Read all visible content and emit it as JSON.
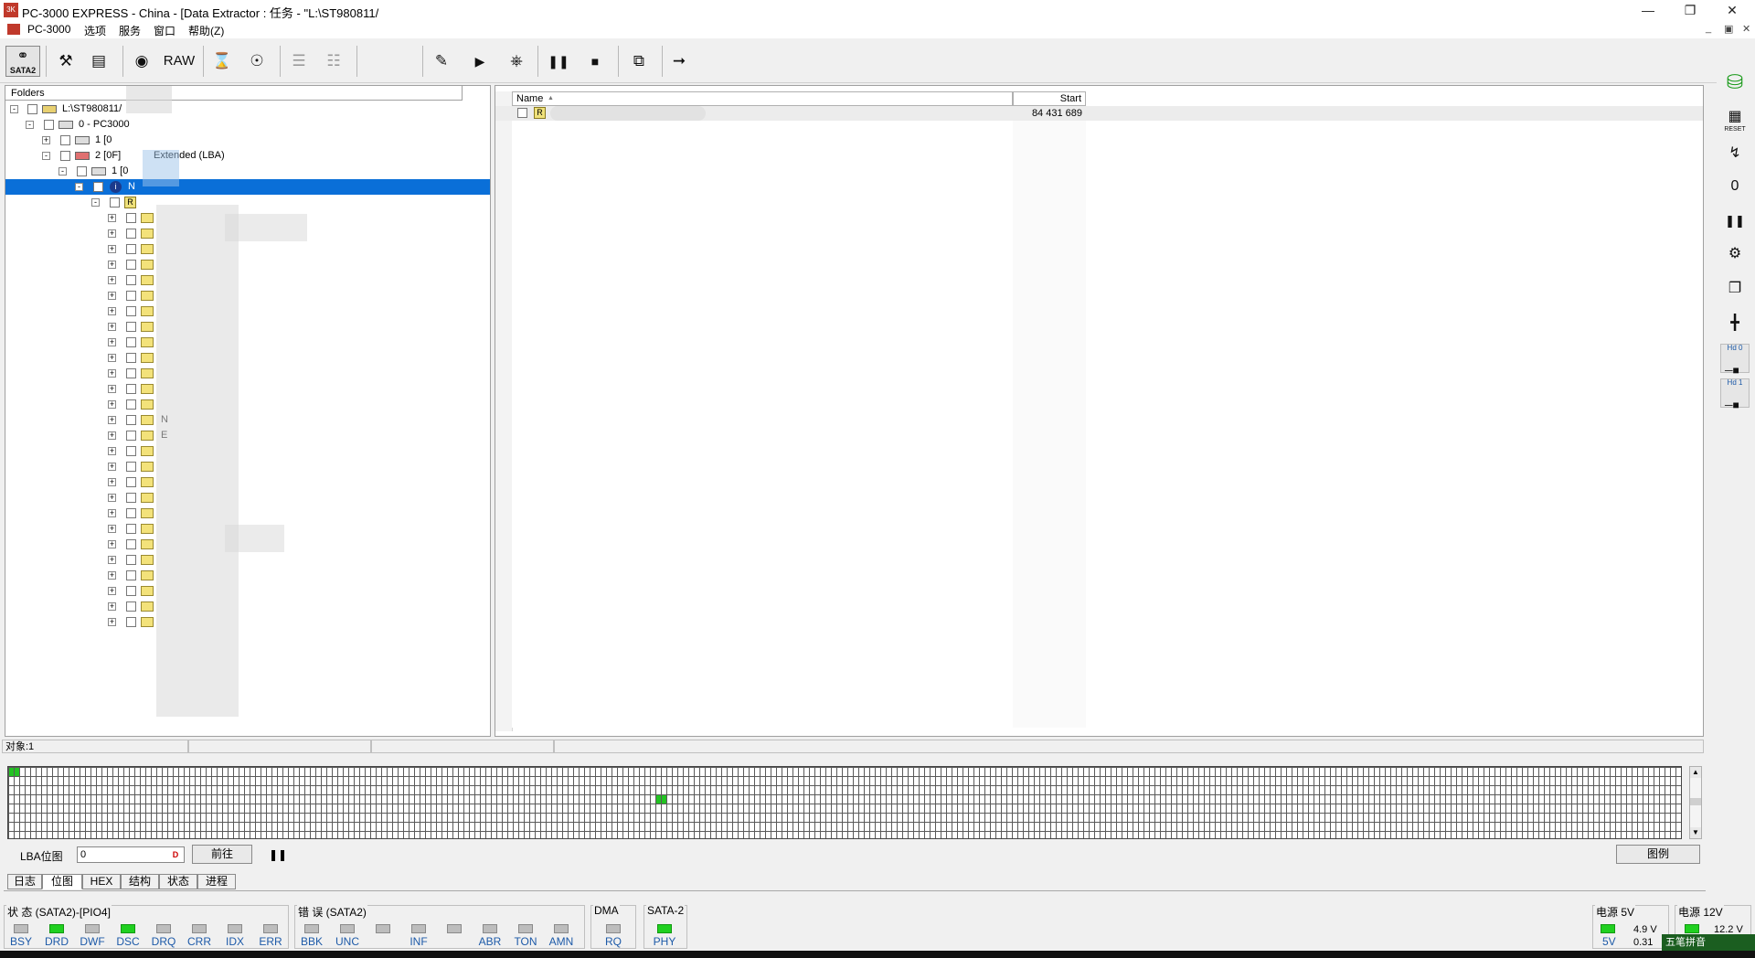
{
  "window": {
    "title": "PC-3000 EXPRESS - China - [Data Extractor : 任务 - \"L:\\ST980811/",
    "app_icon": "pc3000-logo-icon",
    "controls": [
      "minimize",
      "restore",
      "close"
    ]
  },
  "menu": {
    "items": [
      "PC-3000",
      "选项",
      "服务",
      "窗口",
      "帮助(Z)"
    ]
  },
  "toolbar": {
    "sata_label": "SATA2",
    "raw_label": "RAW"
  },
  "side_toolbar": {
    "reset_label": "RESET",
    "hd0_label": "Hd 0",
    "hd1_label": "Hd 1"
  },
  "tree": {
    "header": "Folders",
    "root_label": "L:\\ST980811/",
    "node_device": "0 - PC3000",
    "node_part1": "1 [0",
    "node_part2": "2 [0F]",
    "node_part2_type": "Extended  (LBA)",
    "node_sub1": "1 [0",
    "node_selected": "N",
    "node_root_dir": "R",
    "folder_count": 27,
    "folder_label_n": "N",
    "folder_label_e": "E"
  },
  "list": {
    "columns": [
      "Name",
      "Start"
    ],
    "sort_indicator": "▲",
    "rows": [
      {
        "name_badge": "R",
        "start": "84 431 689"
      }
    ]
  },
  "status": {
    "objects": "对象:1"
  },
  "bitmap": {
    "lba_label": "LBA位图",
    "lba_value": "0",
    "dec_hex_toggle": "D",
    "go_button": "前往",
    "pause_icon": "pause-icon",
    "legend_button": "图例"
  },
  "tabs": [
    "日志",
    "位图",
    "HEX",
    "结构",
    "状态",
    "进程"
  ],
  "active_tab": "位图",
  "indicators": {
    "status_group": {
      "title": "状 态 (SATA2)-[PIO4]",
      "leds": [
        {
          "label": "BSY",
          "on": false
        },
        {
          "label": "DRD",
          "on": true
        },
        {
          "label": "DWF",
          "on": false
        },
        {
          "label": "DSC",
          "on": true
        },
        {
          "label": "DRQ",
          "on": false
        },
        {
          "label": "CRR",
          "on": false
        },
        {
          "label": "IDX",
          "on": false
        },
        {
          "label": "ERR",
          "on": false
        }
      ]
    },
    "error_group": {
      "title": "错 误 (SATA2)",
      "leds": [
        {
          "label": "BBK",
          "on": false
        },
        {
          "label": "UNC",
          "on": false
        },
        {
          "label": "",
          "on": false
        },
        {
          "label": "INF",
          "on": false
        },
        {
          "label": "",
          "on": false
        },
        {
          "label": "ABR",
          "on": false
        },
        {
          "label": "TON",
          "on": false
        },
        {
          "label": "AMN",
          "on": false
        }
      ]
    },
    "dma_group": {
      "title": "DMA",
      "leds": [
        {
          "label": "RQ",
          "on": false
        }
      ]
    },
    "sata_group": {
      "title": "SATA-2",
      "leds": [
        {
          "label": "PHY",
          "on": true
        }
      ]
    },
    "power5": {
      "title": "电源 5V",
      "led_label": "5V",
      "voltage": "4.9 V",
      "current": "0.31"
    },
    "power12": {
      "title": "电源 12V",
      "voltage": "12.2 V"
    }
  },
  "ime": {
    "label": "五笔拼音"
  },
  "colors": {
    "selection": "#0a6fd8",
    "led_on": "#20d020",
    "led_off": "#bdbdbd",
    "indicator_text": "#1d5aa8"
  }
}
